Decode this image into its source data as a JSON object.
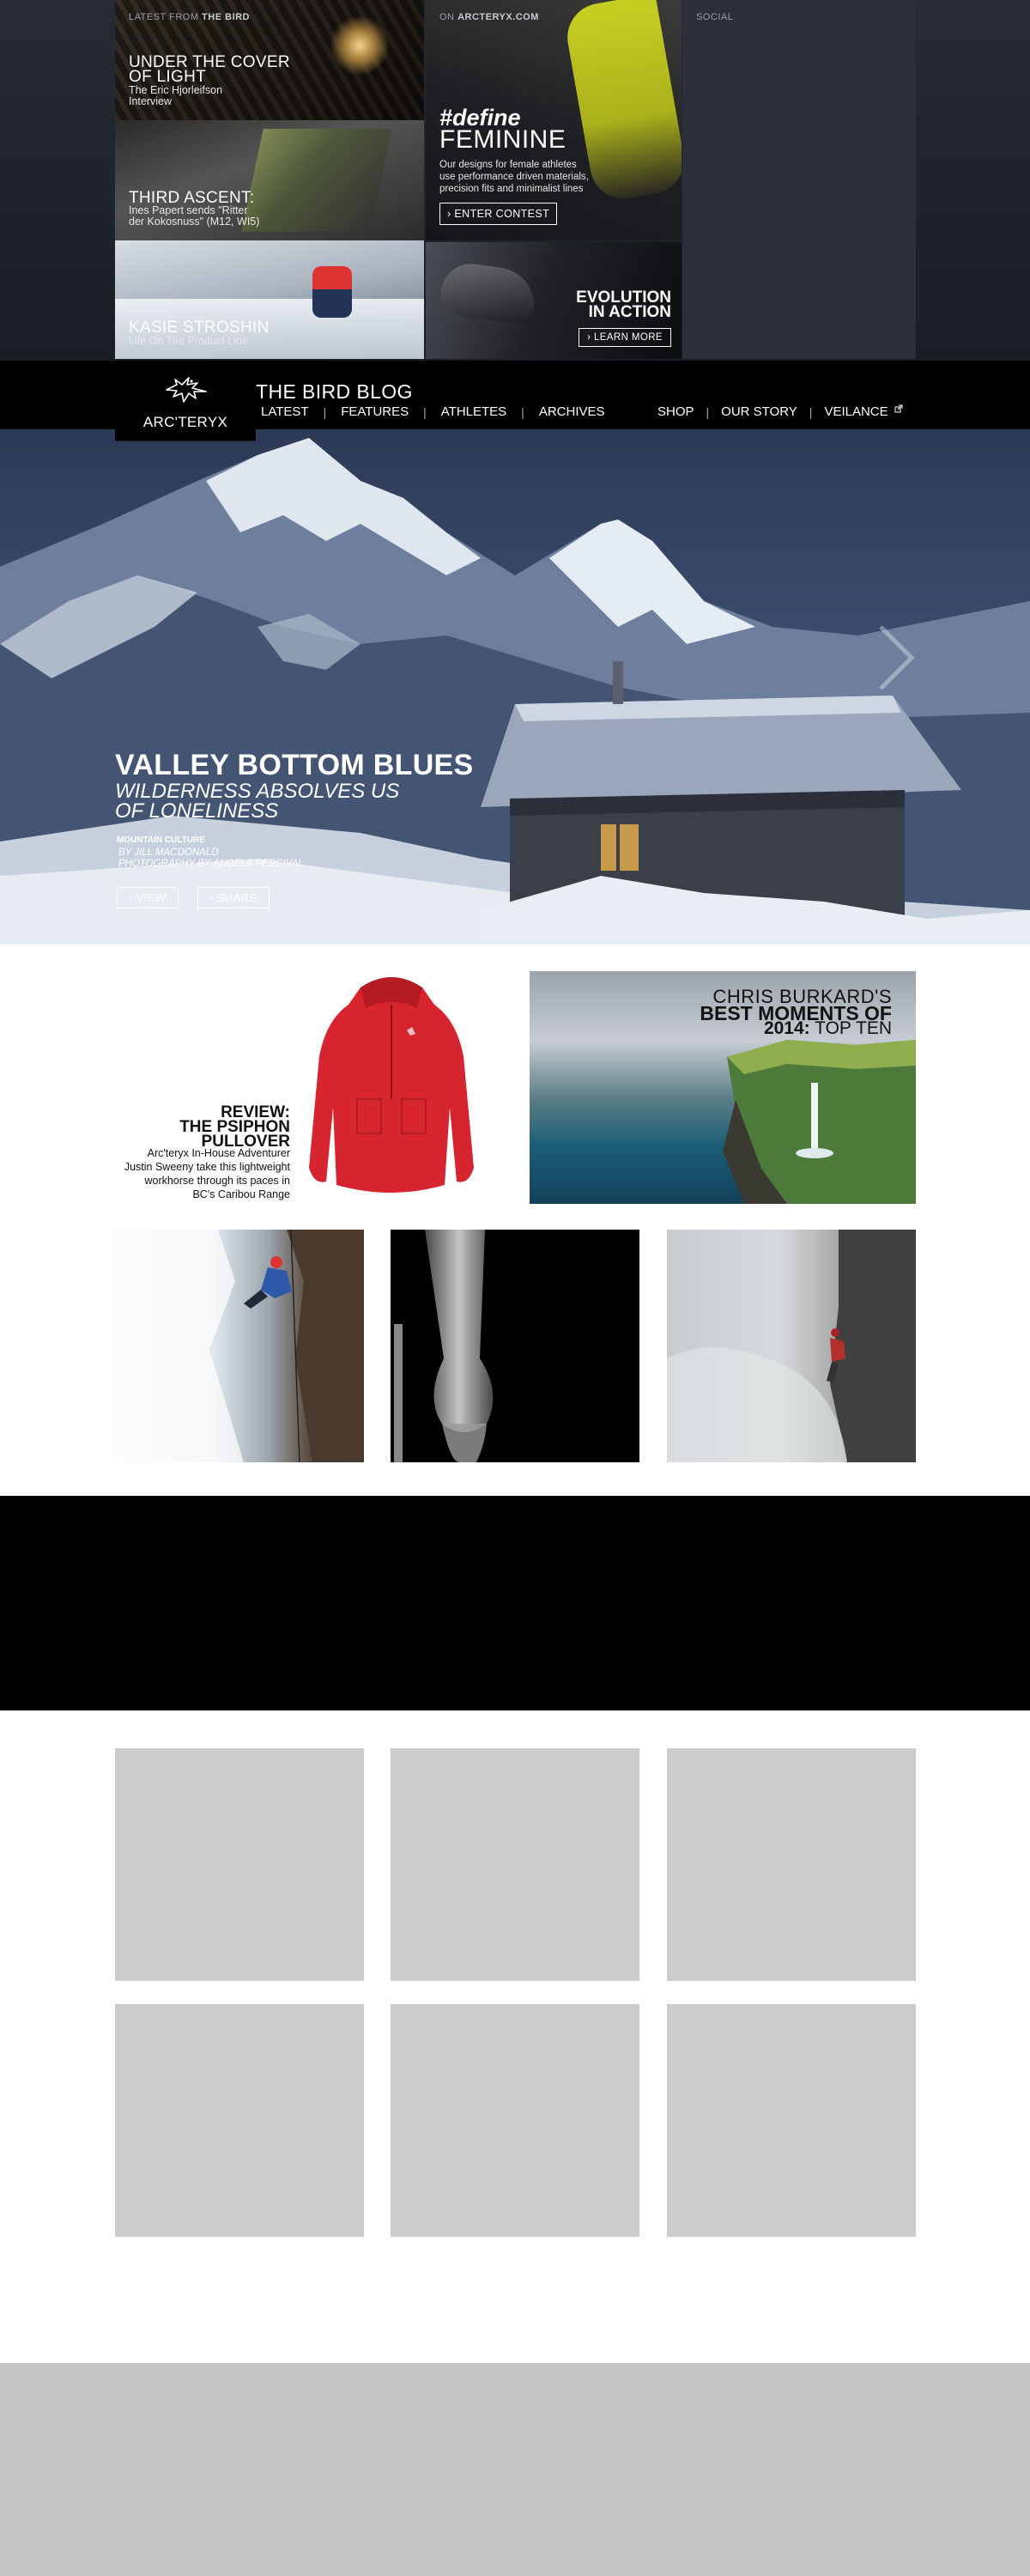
{
  "top_panel": {
    "latest": {
      "prefix": "LATEST FROM ",
      "brand": "THE BIRD"
    },
    "arcteryx": {
      "prefix": "ON ",
      "brand": "ARCTERYX.COM"
    },
    "social": {
      "label": "SOCIAL"
    },
    "tiles": [
      {
        "title_lines": [
          "UNDER THE COVER",
          "OF LIGHT"
        ],
        "sub_lines": [
          "The Eric Hjorleifson",
          "Interview"
        ]
      },
      {
        "title_lines": [
          "THIRD ASCENT:"
        ],
        "sub_lines": [
          "Ines Papert sends \"Ritter",
          "der Kokosnuss\" (M12, WI5)"
        ]
      },
      {
        "title_lines": [
          "KASIE STROSHIN"
        ],
        "sub_lines": [
          "Life On The Product Line"
        ]
      }
    ],
    "feminine": {
      "hashtag": "#define",
      "title": "FEMININE",
      "desc_lines": [
        "Our designs for female athletes",
        "use performance driven materials,",
        "precision fits and minimalist lines"
      ],
      "button": "› ENTER CONTEST"
    },
    "evolution": {
      "title_lines": [
        "EVOLUTION",
        "IN ACTION"
      ],
      "button": "› LEARN MORE"
    }
  },
  "nav": {
    "logo_text": "ARC'TERYX",
    "blog_title": "THE BIRD BLOG",
    "left": [
      "LATEST",
      "FEATURES",
      "ATHLETES",
      "ARCHIVES"
    ],
    "right": [
      "SHOP",
      "OUR STORY",
      "VEILANCE"
    ],
    "external_icon": "external-link-icon"
  },
  "hero": {
    "title": "VALLEY BOTTOM BLUES",
    "subtitle_lines": [
      "WILDERNESS ABSOLVES US",
      "OF LONELINESS"
    ],
    "category": "MOUNTAIN CULTURE",
    "byline": "BY JILL MACDONALD",
    "photo_credit": "PHOTOGRAPHY BY ANGELA PERCIVAL",
    "view_button": "› VIEW",
    "share_button": "› SHARE",
    "next_icon": "chevron-right-icon"
  },
  "featured": {
    "review": {
      "title_lines": [
        "REVIEW:",
        "THE PSIPHON",
        "PULLOVER"
      ],
      "text_lines": [
        "Arc'teryx In-House Adventurer",
        "Justin Sweeny take this lightweight",
        "workhorse through its paces in",
        "BC's Caribou Range"
      ]
    },
    "burkard": {
      "line1": "CHRIS BURKARD'S",
      "line2": "BEST MOMENTS OF",
      "line3_bold": "2014:",
      "line3_rest": " TOP TEN"
    }
  },
  "colors": {
    "nav_bg": "#000000",
    "jacket_red": "#d7252f",
    "placeholder_gray": "#cccccc",
    "footer_gray": "#c4c4c4"
  }
}
